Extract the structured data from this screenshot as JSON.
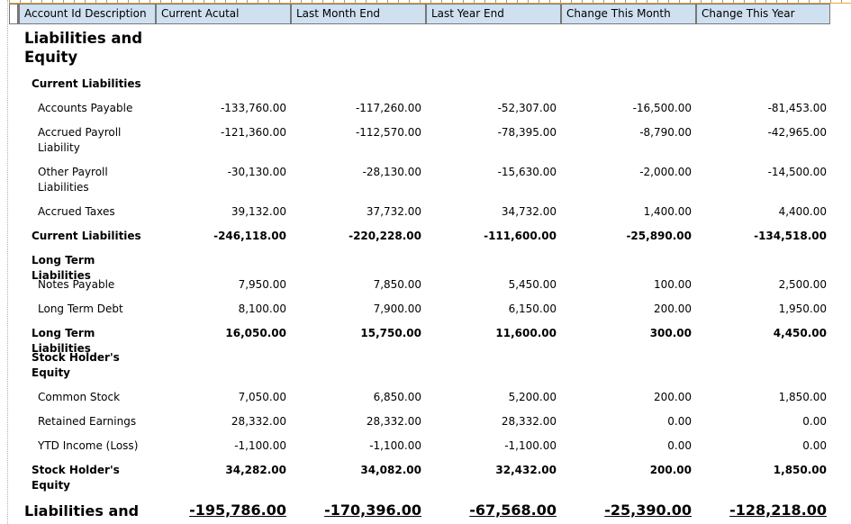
{
  "columns": [
    "Account Id Description",
    "Current Acutal",
    "Last Month End",
    "Last Year End",
    "Change This Month",
    "Change This Year"
  ],
  "title": "Liabilities and Equity",
  "title_line1": "Liabilities and",
  "title_line2": "Equity",
  "sections": [
    {
      "heading": "Current Liabilities",
      "items": [
        {
          "label": "Accounts Payable",
          "label_line2": "",
          "values": [
            "-133,760.00",
            "-117,260.00",
            "-52,307.00",
            "-16,500.00",
            "-81,453.00"
          ]
        },
        {
          "label": "Accrued Payroll",
          "label_line2": "Liability",
          "values": [
            "-121,360.00",
            "-112,570.00",
            "-78,395.00",
            "-8,790.00",
            "-42,965.00"
          ]
        },
        {
          "label": "Other Payroll",
          "label_line2": "Liabilities",
          "values": [
            "-30,130.00",
            "-28,130.00",
            "-15,630.00",
            "-2,000.00",
            "-14,500.00"
          ]
        },
        {
          "label": "Accrued Taxes",
          "label_line2": "",
          "values": [
            "39,132.00",
            "37,732.00",
            "34,732.00",
            "1,400.00",
            "4,400.00"
          ]
        }
      ],
      "total": {
        "label": "Current Liabilities",
        "label_line2": "",
        "values": [
          "-246,118.00",
          "-220,228.00",
          "-111,600.00",
          "-25,890.00",
          "-134,518.00"
        ]
      }
    },
    {
      "heading": "Long Term Liabilities",
      "items": [
        {
          "label": "Notes Payable",
          "label_line2": "",
          "values": [
            "7,950.00",
            "7,850.00",
            "5,450.00",
            "100.00",
            "2,500.00"
          ]
        },
        {
          "label": "Long Term Debt",
          "label_line2": "",
          "values": [
            "8,100.00",
            "7,900.00",
            "6,150.00",
            "200.00",
            "1,950.00"
          ]
        }
      ],
      "total": {
        "label": "Long Term Liabilities",
        "label_line2": "",
        "values": [
          "16,050.00",
          "15,750.00",
          "11,600.00",
          "300.00",
          "4,450.00"
        ]
      }
    },
    {
      "heading": "Stock Holder's",
      "heading_line2": "Equity",
      "items": [
        {
          "label": "Common Stock",
          "label_line2": "",
          "values": [
            "7,050.00",
            "6,850.00",
            "5,200.00",
            "200.00",
            "1,850.00"
          ]
        },
        {
          "label": "Retained Earnings",
          "label_line2": "",
          "values": [
            "28,332.00",
            "28,332.00",
            "28,332.00",
            "0.00",
            "0.00"
          ]
        },
        {
          "label": "YTD Income (Loss)",
          "label_line2": "",
          "values": [
            "-1,100.00",
            "-1,100.00",
            "-1,100.00",
            "0.00",
            "0.00"
          ]
        }
      ],
      "total": {
        "label": "Stock Holder's",
        "label_line2": "Equity",
        "values": [
          "34,282.00",
          "34,082.00",
          "32,432.00",
          "200.00",
          "1,850.00"
        ]
      }
    }
  ],
  "grand_total": {
    "label": "Liabilities and",
    "values": [
      "-195,786.00",
      "-170,396.00",
      "-67,568.00",
      "-25,390.00",
      "-128,218.00"
    ]
  }
}
